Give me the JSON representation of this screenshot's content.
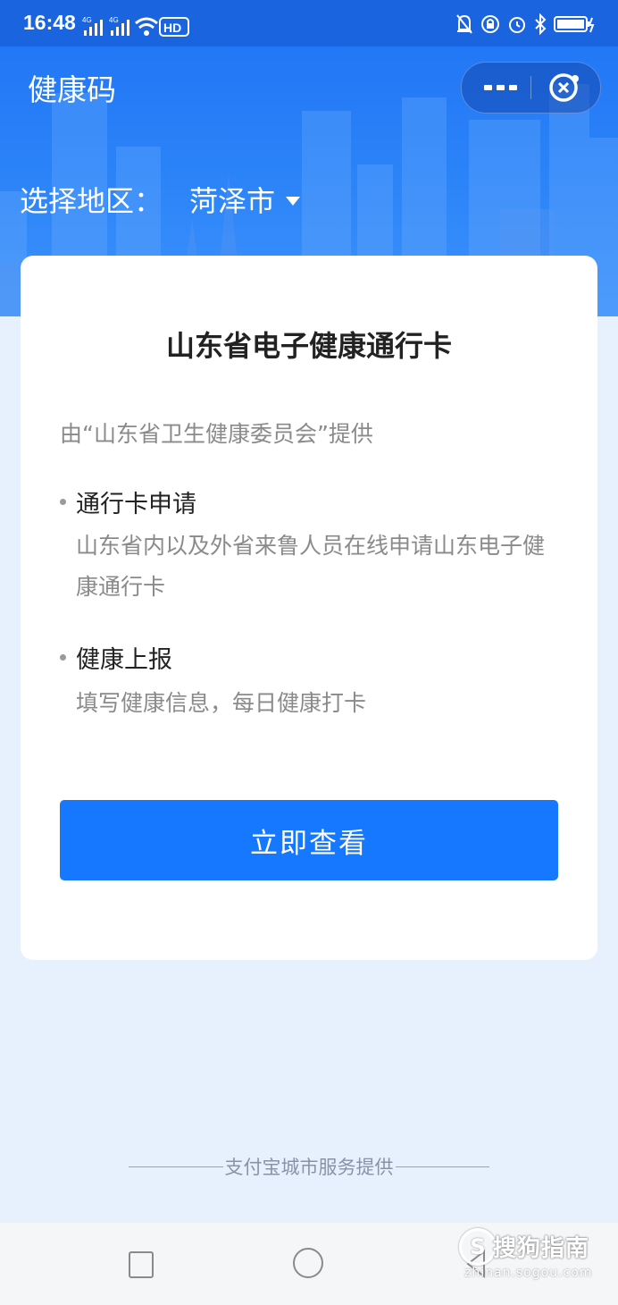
{
  "status_bar": {
    "time": "16:48",
    "signal1_label": "4G",
    "signal2_label": "4G",
    "hd_label": "HD",
    "icons": [
      "bell-off-icon",
      "lock-rotation-icon",
      "alarm-icon",
      "bluetooth-icon",
      "battery-charging-icon"
    ]
  },
  "header": {
    "title": "健康码",
    "more_icon": "more-dots-icon",
    "close_icon": "close-mini-program-icon"
  },
  "region": {
    "label": "选择地区：",
    "city": "菏泽市"
  },
  "card": {
    "title": "山东省电子健康通行卡",
    "provider": "由“山东省卫生健康委员会”提供",
    "items": [
      {
        "title": "通行卡申请",
        "desc": "山东省内以及外省来鲁人员在线申请山东电子健康通行卡"
      },
      {
        "title": "健康上报",
        "desc": "填写健康信息，每日健康打卡"
      }
    ],
    "button_label": "立即查看"
  },
  "footer": {
    "text": "支付宝城市服务提供"
  },
  "nav": {
    "icons": [
      "recent-apps-icon",
      "home-icon",
      "back-icon"
    ]
  },
  "watermark": {
    "logo_letter": "S",
    "text": "搜狗指南",
    "url": "zhinan.sogou.com"
  },
  "colors": {
    "primary": "#1677ff",
    "header_blue": "#1f73f5",
    "page_bg": "#e7f1fe"
  }
}
